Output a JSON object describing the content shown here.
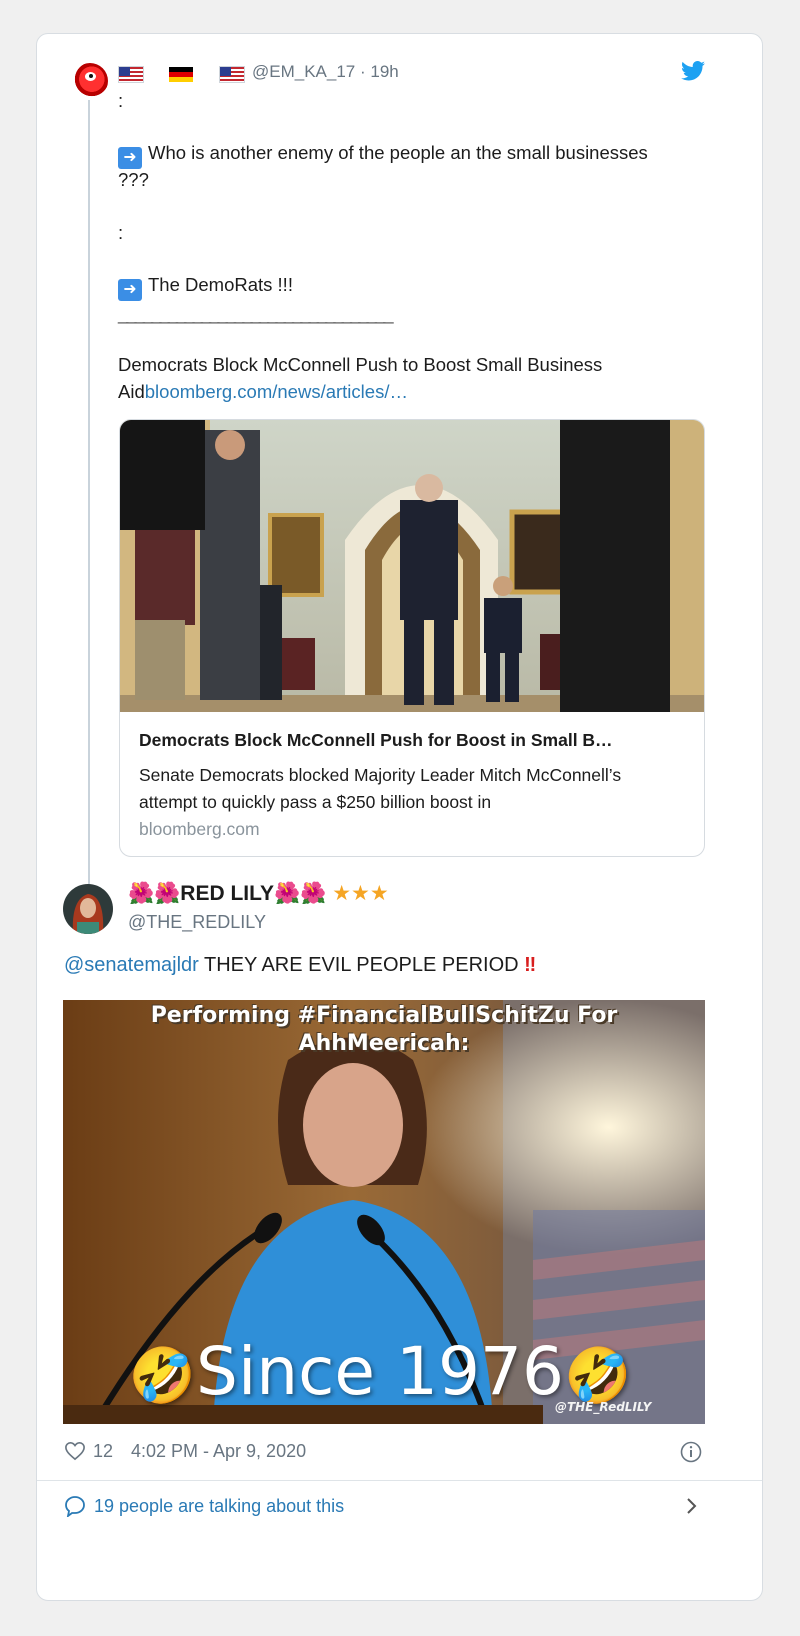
{
  "tweet1": {
    "handle": "@EM_KA_17",
    "time": "19h",
    "handle_line": "@EM_KA_17 · 19h",
    "lines": [
      ":",
      "Who is another enemy of the people an the small businesses",
      "???",
      ":",
      "The DemoRats !!!",
      "_________________________________",
      "Democrats Block McConnell Push to Boost Small Business",
      "Aid"
    ],
    "inline_link": "bloomberg.com/news/articles/…",
    "card": {
      "title": "Democrats Block McConnell Push for Boost in Small B…",
      "description": "Senate Democrats blocked Majority Leader Mitch McConnell’s attempt to quickly pass a $250 billion boost in",
      "domain": "bloomberg.com"
    },
    "flags": [
      "us-flag-icon",
      "germany-flag-icon",
      "us-flag-icon"
    ]
  },
  "tweet2": {
    "name_prefix": "🌺🌺",
    "name": "RED LILY",
    "name_suffix": "🌺🌺",
    "stars": "★★★",
    "handle": "@THE_REDLILY",
    "mention": "@senatemajldr",
    "text": " THEY ARE EVIL PEOPLE PERIOD ",
    "bang": "‼",
    "meme": {
      "caption_line1": "Performing #FinancialBullSchitZu For",
      "caption_line2": "AhhMeericah:",
      "since_text": "Since 1976",
      "signature": "@THE_RedLILY"
    }
  },
  "footer": {
    "likes": "12",
    "timestamp": "4:02 PM - Apr 9, 2020",
    "talking": "19 people are talking about this"
  },
  "colors": {
    "link": "#2a7ab5",
    "twitter_blue": "#1da1f2",
    "muted": "#687581",
    "star": "#f5a524"
  }
}
